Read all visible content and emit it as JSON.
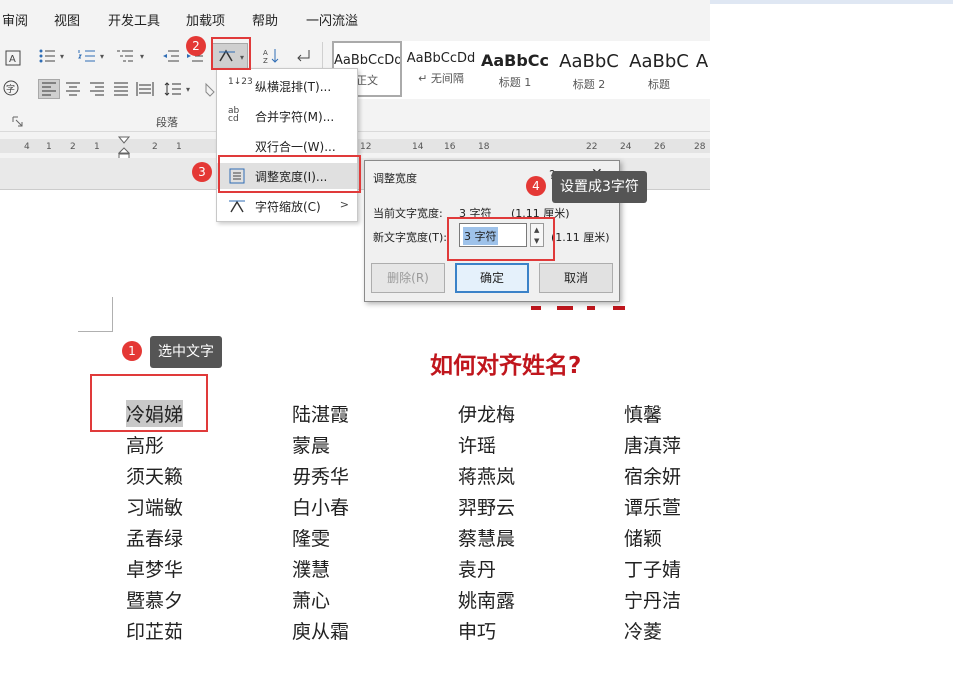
{
  "menubar": {
    "items": [
      "审阅",
      "视图",
      "开发工具",
      "加载项",
      "帮助",
      "一闪流溢"
    ]
  },
  "ribbon": {
    "paragraph_group_label": "段落",
    "styles": [
      {
        "sample": "AaBbCcDd",
        "name": "正文"
      },
      {
        "sample": "AaBbCcDd",
        "name": "↵ 无间隔"
      },
      {
        "sample": "AaBbCc",
        "name": "标题 1"
      },
      {
        "sample": "AaBbC",
        "name": "标题 2"
      },
      {
        "sample": "AaBbC",
        "name": "标题"
      },
      {
        "sample": "A",
        "name": ""
      }
    ]
  },
  "ruler": {
    "ticks": [
      "4",
      "1",
      "2",
      "1",
      "2",
      "1",
      "12",
      "14",
      "16",
      "18",
      "22",
      "24",
      "26",
      "28"
    ]
  },
  "dropdown": {
    "items": [
      {
        "icon": "1↓23",
        "label": "纵横混排(T)..."
      },
      {
        "icon": "ab cd",
        "label": "合并字符(M)..."
      },
      {
        "icon": "",
        "label": "双行合一(W)..."
      },
      {
        "icon": "",
        "label": "调整宽度(I)..."
      },
      {
        "icon": "",
        "label": "字符缩放(C)"
      }
    ]
  },
  "dialog": {
    "title": "调整宽度",
    "help": "?",
    "close": "✕",
    "current_label": "当前文字宽度:",
    "current_value": "3 字符",
    "current_cm": "(1.11 厘米)",
    "new_label": "新文字宽度(T):",
    "new_value": "3 字符",
    "new_cm": "(1.11 厘米)",
    "delete_label": "删除(R)",
    "ok_label": "确定",
    "cancel_label": "取消"
  },
  "callouts": {
    "step1": {
      "num": "1",
      "text": "选中文字"
    },
    "step2": {
      "num": "2"
    },
    "step3": {
      "num": "3"
    },
    "step4": {
      "num": "4",
      "text": "设置成3字符"
    }
  },
  "document": {
    "title": "如何对齐姓名?",
    "columns": [
      [
        "冷娟娣",
        "高彤",
        "须天籁",
        "习端敏",
        "孟春绿",
        "卓梦华",
        "暨慕夕",
        "印芷茹"
      ],
      [
        "陆湛霞",
        "蒙晨",
        "毋秀华",
        "白小春",
        "隆雯",
        "濮慧",
        "萧心",
        "庾从霜"
      ],
      [
        "伊龙梅",
        "许瑶",
        "蒋燕岚",
        "羿野云",
        "蔡慧晨",
        "袁丹",
        "姚南露",
        "申巧"
      ],
      [
        "慎馨",
        "唐滇萍",
        "宿余妍",
        "谭乐萱",
        "储颖",
        "丁子婧",
        "宁丹洁",
        "冷菱"
      ]
    ]
  },
  "colors": {
    "accent_red": "#e43835",
    "title_red": "#c0161d",
    "ok_border": "#3b82c8"
  }
}
